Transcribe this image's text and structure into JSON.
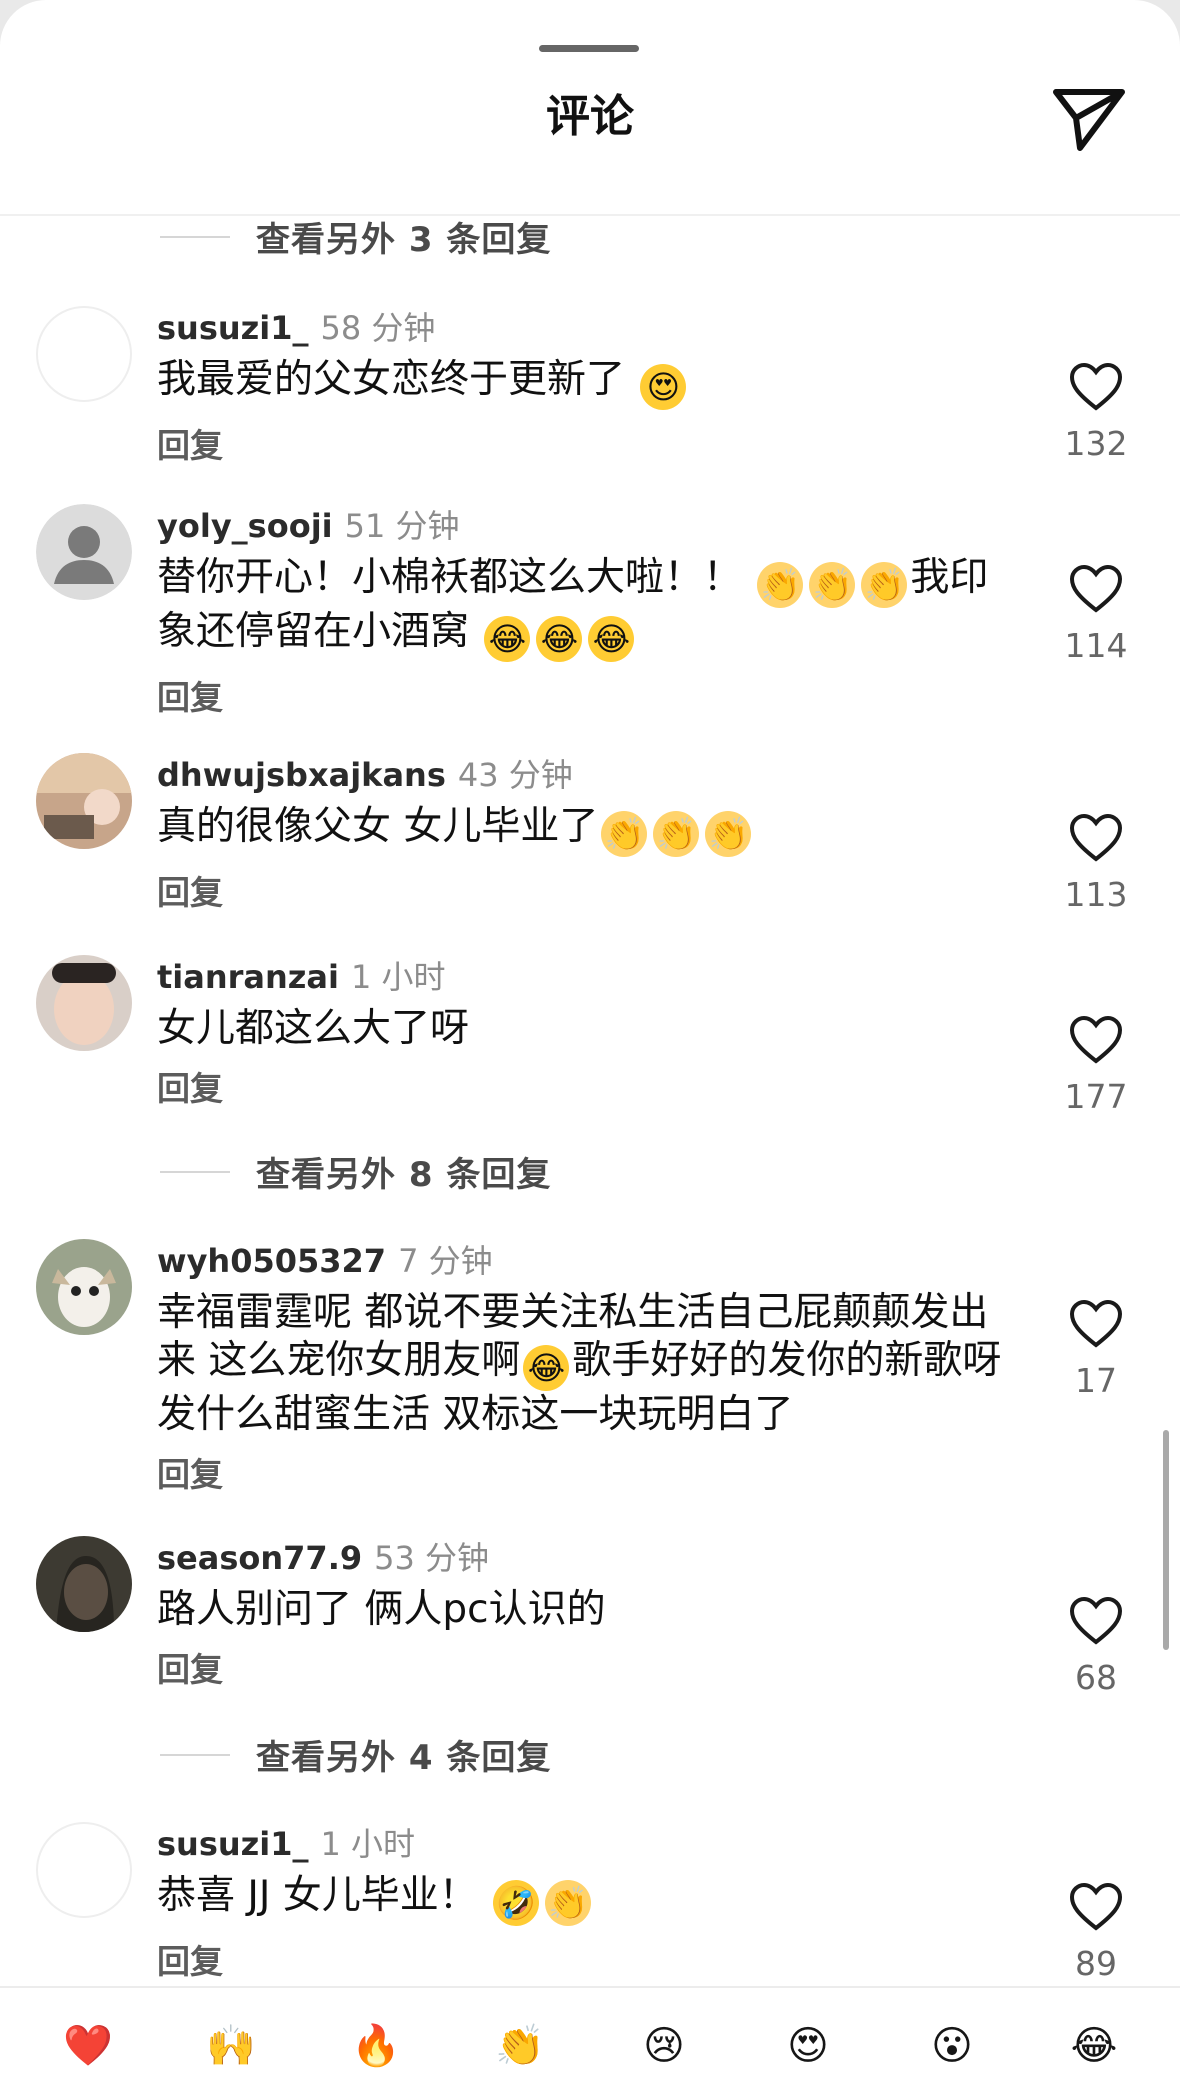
{
  "header": {
    "title": "评论",
    "send_icon": "send-paper-plane-icon"
  },
  "view_more": [
    {
      "label": "查看另外 3 条回复"
    },
    {
      "label": "查看另外 8 条回复"
    },
    {
      "label": "查看另外 4 条回复"
    }
  ],
  "comments": [
    {
      "user": "susuzi1_",
      "time": "58 分钟",
      "text": "我最爱的父女恋终于更新了",
      "emojis": [
        "😍"
      ],
      "reply": "回复",
      "likes": "132",
      "avatar": "blank"
    },
    {
      "user": "yoly_sooji",
      "time": "51 分钟",
      "text_1": "替你开心！小棉袄都这么大啦！！",
      "emojis_1": [
        "👏",
        "👏",
        "👏"
      ],
      "text_2": "我印象还停留在小酒窝",
      "emojis_2": [
        "😂",
        "😂",
        "😂"
      ],
      "reply": "回复",
      "likes": "114",
      "avatar": "default-person"
    },
    {
      "user": "dhwujsbxajkans",
      "time": "43 分钟",
      "text": "真的很像父女 女儿毕业了",
      "emojis": [
        "👏",
        "👏",
        "👏"
      ],
      "reply": "回复",
      "likes": "113",
      "avatar": "photo"
    },
    {
      "user": "tianranzai",
      "time": "1 小时",
      "text": "女儿都这么大了呀",
      "reply": "回复",
      "likes": "177",
      "avatar": "photo"
    },
    {
      "user": "wyh0505327",
      "time": "7 分钟",
      "text_1": "幸福雷霆呢 都说不要关注私生活自己屁颠颠发出来 这么宠你女朋友啊",
      "emojis_1": [
        "😂"
      ],
      "text_2": "歌手好好的发你的新歌呀 发什么甜蜜生活 双标这一块玩明白了",
      "reply": "回复",
      "likes": "17",
      "avatar": "photo"
    },
    {
      "user": "season77.9",
      "time": "53 分钟",
      "text": "路人别问了 俩人pc认识的",
      "reply": "回复",
      "likes": "68",
      "avatar": "photo"
    },
    {
      "user": "susuzi1_",
      "time": "1 小时",
      "text": "恭喜 JJ 女儿毕业！",
      "emojis": [
        "🤣",
        "👏"
      ],
      "reply": "回复",
      "likes": "89",
      "avatar": "blank"
    }
  ],
  "reactions": [
    "❤️",
    "🙌",
    "🔥",
    "👏",
    "😢",
    "😍",
    "😮",
    "😂"
  ],
  "colors": {
    "heart_outline": "#1a1a1a",
    "muted_text": "#8c8c8c",
    "background": "#ffffff"
  }
}
